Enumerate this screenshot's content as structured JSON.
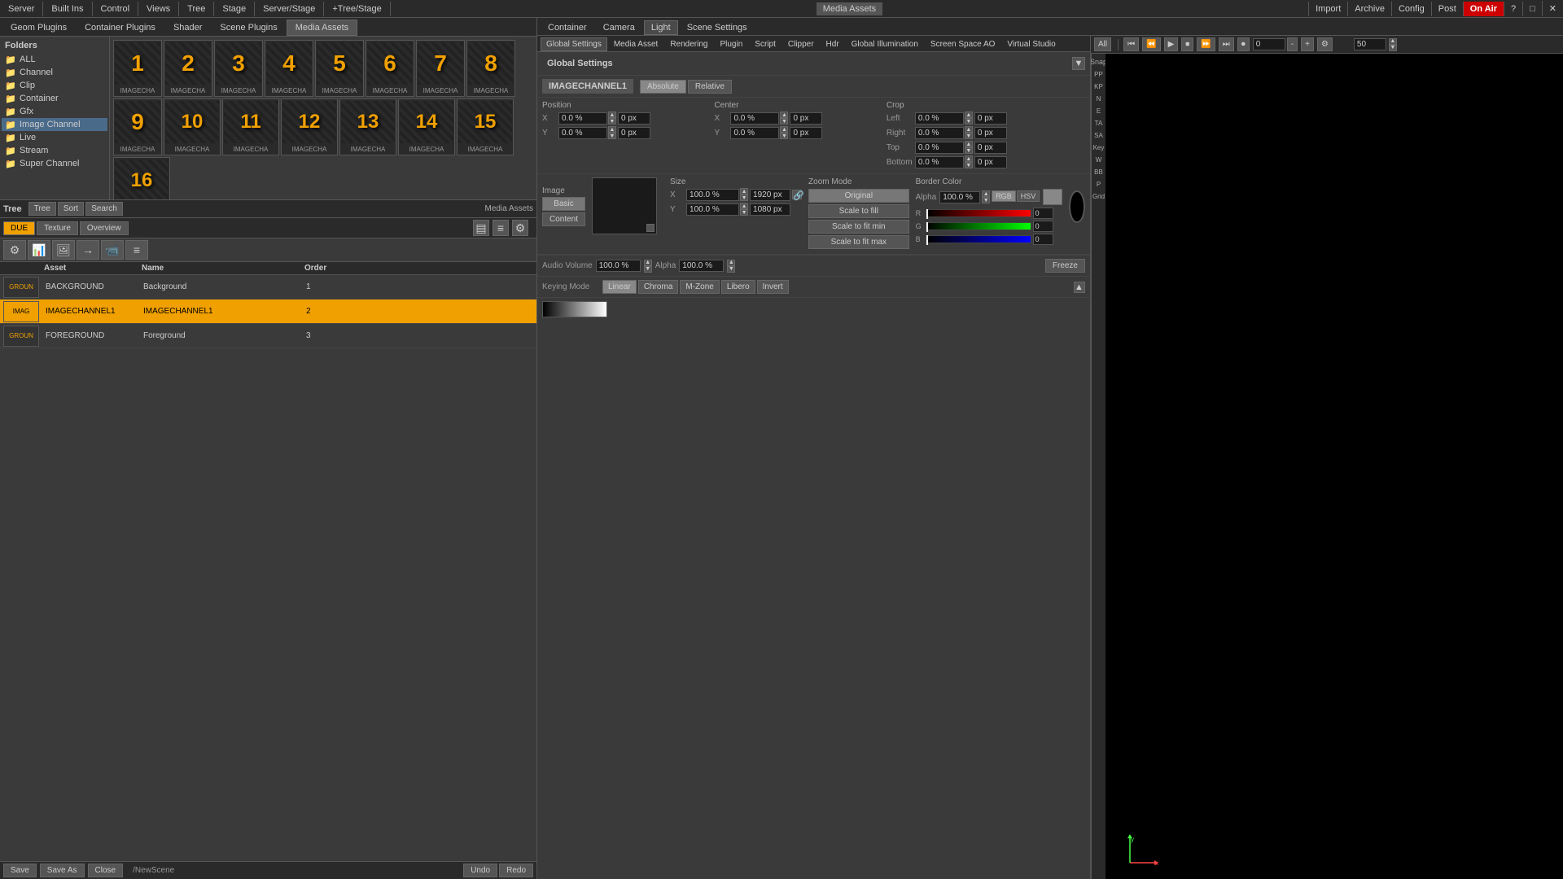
{
  "topbar": {
    "items": [
      "Server",
      "Built Ins",
      "Control",
      "Views",
      "Tree",
      "Stage",
      "Server/Stage",
      "+Tree/Stage"
    ],
    "right_items": [
      "Import",
      "Archive",
      "Config",
      "Post",
      "On Air",
      "?",
      "□",
      "✕"
    ],
    "media_assets_label": "Media Assets"
  },
  "right_top_tabs": {
    "tabs": [
      "Container",
      "Camera",
      "Light",
      "Scene Settings"
    ],
    "active": "Light"
  },
  "settings_tabs": {
    "tabs": [
      "Global Settings",
      "Media Asset",
      "Rendering",
      "Plugin",
      "Script",
      "Clipper",
      "Hdr",
      "Global Illumination",
      "Screen Space AO",
      "Virtual Studio"
    ],
    "active": "Global Settings"
  },
  "global_settings": {
    "header": "Global Settings",
    "channel_id": "IMAGECHANNEL1",
    "absolute_label": "Absolute",
    "relative_label": "Relative",
    "position": {
      "title": "Position",
      "x_label": "X",
      "y_label": "Y",
      "x_val": "0.0 %",
      "y_val": "0.0 %",
      "x_px": "0 px",
      "y_px": "0 px"
    },
    "center": {
      "title": "Center",
      "x_label": "X",
      "y_label": "Y",
      "x_val": "0.0 %",
      "y_val": "0.0 %",
      "x_px": "0 px",
      "y_px": "0 px"
    },
    "crop": {
      "title": "Crop",
      "left_label": "Left",
      "right_label": "Right",
      "top_label": "Top",
      "bottom_label": "Bottom",
      "left_val": "0.0 %",
      "right_val": "0.0 %",
      "top_val": "0.0 %",
      "bottom_val": "0.0 %",
      "left_px": "0 px",
      "right_px": "0 px",
      "top_px": "0 px",
      "bottom_px": "0 px"
    },
    "size": {
      "title": "Size",
      "x_label": "X",
      "y_label": "Y",
      "x_val": "100.0 %",
      "y_val": "100.0 %",
      "x_px": "1920 px",
      "y_px": "1080 px"
    },
    "zoom_mode": {
      "title": "Zoom Mode",
      "options": [
        "Original",
        "Scale to fill",
        "Scale to fit min",
        "Scale to fit max"
      ]
    },
    "border_color": {
      "title": "Border Color",
      "alpha_label": "Alpha",
      "alpha_val": "100.0 %",
      "rgb_label": "RGB",
      "hsv_label": "HSV",
      "r_label": "R",
      "g_label": "G",
      "b_label": "B",
      "r_val": "0",
      "g_val": "0",
      "b_val": "0"
    },
    "image_label": "Image",
    "basic_label": "Basic",
    "content_label": "Content",
    "audio_volume_label": "Audio Volume",
    "audio_volume_val": "100.0 %",
    "alpha_label": "Alpha",
    "alpha_val": "100.0 %",
    "freeze_label": "Freeze",
    "keying_mode_label": "Keying Mode",
    "keying_btns": [
      "Linear",
      "Chroma",
      "M-Zone",
      "Libero"
    ],
    "invert_label": "Invert"
  },
  "plugin_tabs": {
    "tabs": [
      "Geom Plugins",
      "Container Plugins",
      "Shader",
      "Scene Plugins",
      "Media Assets"
    ],
    "active": "Media Assets"
  },
  "folders": {
    "title": "Folders",
    "items": [
      "ALL",
      "Channel",
      "Clip",
      "Container",
      "Gfx",
      "Image Channel",
      "Live",
      "Stream",
      "Super Channel"
    ],
    "active": "Image Channel"
  },
  "image_thumbs": {
    "items": [
      {
        "num": "1",
        "label": "IMAGECHA"
      },
      {
        "num": "2",
        "label": "IMAGECHA"
      },
      {
        "num": "3",
        "label": "IMAGECHA"
      },
      {
        "num": "4",
        "label": "IMAGECHA"
      },
      {
        "num": "5",
        "label": "IMAGECHA"
      },
      {
        "num": "6",
        "label": "IMAGECHA"
      },
      {
        "num": "7",
        "label": "IMAGECHA"
      },
      {
        "num": "8",
        "label": "IMAGECHA"
      },
      {
        "num": "9",
        "label": "IMAGECHA"
      },
      {
        "num": "10",
        "label": "IMAGECHA"
      },
      {
        "num": "11",
        "label": "IMAGECHA"
      },
      {
        "num": "12",
        "label": "IMAGECHA"
      },
      {
        "num": "13",
        "label": "IMAGECHA"
      },
      {
        "num": "14",
        "label": "IMAGECHA"
      },
      {
        "num": "15",
        "label": "IMAGECHA"
      },
      {
        "num": "16",
        "label": "IMAGECHA"
      }
    ]
  },
  "tree": {
    "title": "Tree",
    "buttons": [
      "Tree",
      "Sort",
      "Search"
    ]
  },
  "media_assets_tabs": {
    "title": "Media Assets",
    "tabs": [
      "DUE",
      "Texture",
      "Overview"
    ],
    "active": "DUE"
  },
  "asset_table": {
    "headers": [
      "Asset",
      "Name",
      "Order"
    ],
    "rows": [
      {
        "thumb_label": "GROUN",
        "asset": "BACKGROUND",
        "name": "Background",
        "order": "1",
        "selected": false
      },
      {
        "thumb_label": "IMAG",
        "asset": "IMAGECHANNEL1",
        "name": "IMAGECHANNEL1",
        "order": "2",
        "selected": true
      },
      {
        "thumb_label": "GROUN",
        "asset": "FOREGROUND",
        "name": "Foreground",
        "order": "3",
        "selected": false
      }
    ]
  },
  "bottom_bar": {
    "save_label": "Save",
    "save_as_label": "Save As",
    "close_label": "Close",
    "scene_path": "/NewScene",
    "undo_label": "Undo",
    "redo_label": "Redo"
  },
  "timeline": {
    "all_label": "All",
    "frame_val": "0",
    "end_val": "50"
  },
  "snap_items": [
    "Snap",
    "PP",
    "KP",
    "N",
    "E",
    "TA",
    "SA",
    "Key",
    "W",
    "BB",
    "P",
    "Grid"
  ],
  "viewport": {
    "coord_x": "X",
    "coord_y": "Y"
  }
}
